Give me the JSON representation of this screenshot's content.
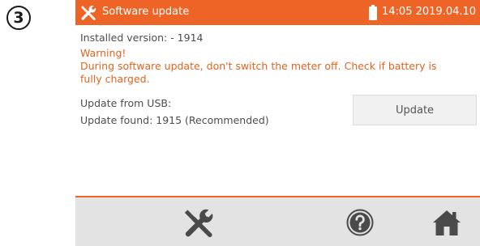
{
  "step": {
    "number": "3"
  },
  "titlebar": {
    "title": "Software update",
    "datetime": "14:05 2019.04.10",
    "icon": "tools-icon",
    "battery_icon": "battery-icon"
  },
  "content": {
    "installed_version": "Installed version: - 1914",
    "warning_title": "Warning!",
    "warning_line1": "During software update, don't switch the meter off. Check if battery is",
    "warning_line2": "fully charged.",
    "update_from": "Update from USB:",
    "update_found": "Update found: 1915 (Recommended)",
    "update_button": "Update"
  },
  "footer": {
    "icons": [
      "settings-icon",
      "help-icon",
      "home-icon"
    ]
  },
  "colors": {
    "accent": "#ee6426",
    "warning_text": "#e0641f",
    "footer_bg": "#e3e3e3",
    "text": "#4d4d4d"
  }
}
